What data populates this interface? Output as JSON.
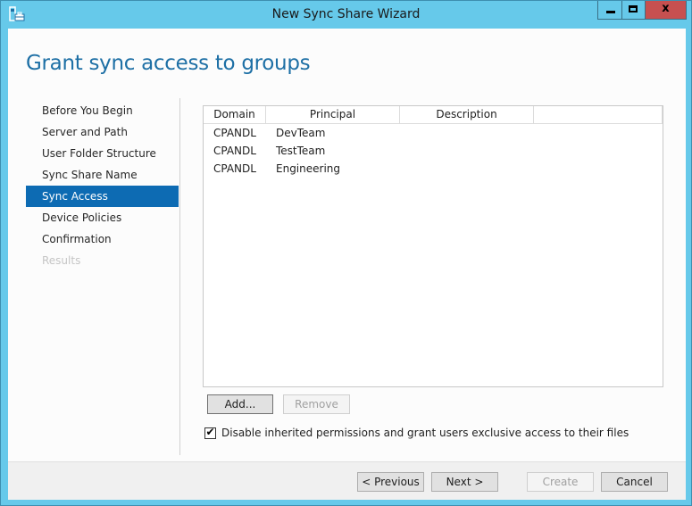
{
  "window": {
    "title": "New Sync Share Wizard",
    "close_glyph": "x"
  },
  "page": {
    "heading": "Grant sync access to groups"
  },
  "steps": [
    {
      "label": "Before You Begin",
      "state": "normal"
    },
    {
      "label": "Server and Path",
      "state": "normal"
    },
    {
      "label": "User Folder Structure",
      "state": "normal"
    },
    {
      "label": "Sync Share Name",
      "state": "normal"
    },
    {
      "label": "Sync Access",
      "state": "active"
    },
    {
      "label": "Device Policies",
      "state": "normal"
    },
    {
      "label": "Confirmation",
      "state": "normal"
    },
    {
      "label": "Results",
      "state": "disabled"
    }
  ],
  "grid": {
    "columns": [
      "Domain",
      "Principal",
      "Description",
      ""
    ],
    "rows": [
      {
        "domain": "CPANDL",
        "principal": "DevTeam",
        "description": ""
      },
      {
        "domain": "CPANDL",
        "principal": "TestTeam",
        "description": ""
      },
      {
        "domain": "CPANDL",
        "principal": "Engineering",
        "description": ""
      }
    ]
  },
  "actions": {
    "add_label": "Add...",
    "remove_label": "Remove"
  },
  "options": {
    "disable_inherited_label": "Disable inherited permissions and grant users exclusive access to their files",
    "disable_inherited_checked": true,
    "check_glyph": "✔"
  },
  "footer": {
    "previous_label": "< Previous",
    "next_label": "Next >",
    "create_label": "Create",
    "cancel_label": "Cancel"
  }
}
